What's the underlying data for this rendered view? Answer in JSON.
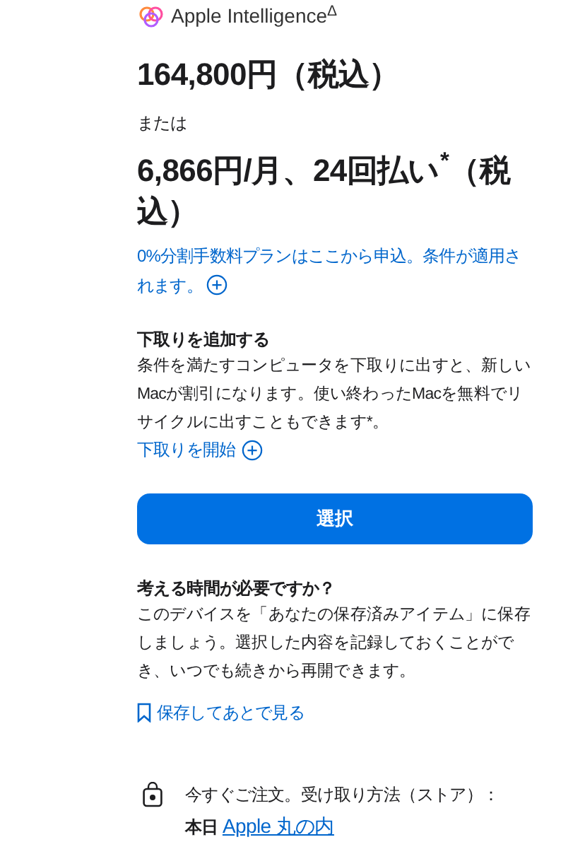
{
  "feature": {
    "label": "Apple Intelligence$^{Δ}$"
  },
  "price": {
    "full": "164,800円（税込）",
    "or": "または",
    "monthly": "6,866円/月、24回払い$^{*}$（税込）"
  },
  "financing_link": {
    "text": "0%分割手数料プランはここから申込。条件が適用されます。"
  },
  "trade_in": {
    "title": "下取りを追加する",
    "body": "条件を満たすコンピュータを下取りに出すと、新しいMacが割引になります。使い終わったMacを無料でリサイクルに出すこともできます*。",
    "link": "下取りを開始"
  },
  "select_button": {
    "label": "選択"
  },
  "save": {
    "title": "考える時間が必要ですか？",
    "body": "このデバイスを「あなたの保存済みアイテム」に保存しましょう。選択した内容を記録しておくことができ、いつでも続きから再開できます。",
    "link": "保存してあとで見る"
  },
  "pickup": {
    "text": "今すぐご注文。受け取り方法（ストア）：",
    "day": "本日",
    "store": "Apple 丸の内"
  }
}
